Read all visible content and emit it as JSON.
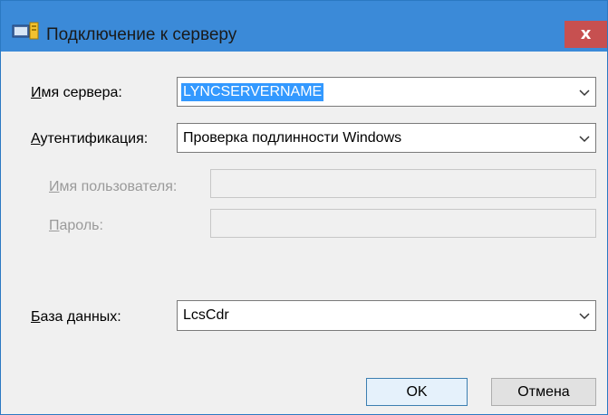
{
  "window": {
    "title": "Подключение к серверу",
    "close_glyph": "x",
    "title_icon": "server-connect-icon",
    "colors": {
      "titlebar": "#3b8ad8",
      "close": "#c75050",
      "selection": "#3399ff"
    }
  },
  "form": {
    "server_name": {
      "label_accel": "И",
      "label_rest": "мя сервера:",
      "value": "LYNCSERVERNAME"
    },
    "authentication": {
      "label_accel": "А",
      "label_rest": "утентификация:",
      "value": "Проверка подлинности Windows"
    },
    "username": {
      "label_accel": "И",
      "label_rest": "мя пользователя:",
      "value": ""
    },
    "password": {
      "label_accel": "П",
      "label_rest": "ароль:",
      "value": ""
    },
    "database": {
      "label_accel": "Б",
      "label_rest": "аза данных:",
      "value": "LcsCdr"
    }
  },
  "buttons": {
    "ok": "OK",
    "cancel": "Отмена"
  }
}
